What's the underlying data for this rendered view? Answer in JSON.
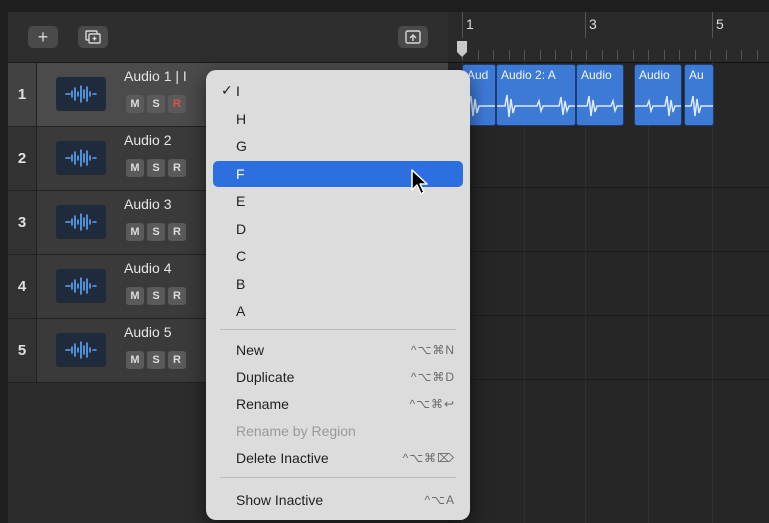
{
  "toolbar": {
    "add_label": "+"
  },
  "tracks": [
    {
      "number": "1",
      "name": "Audio 1 | I",
      "mute": "M",
      "solo": "S",
      "rec": "R"
    },
    {
      "number": "2",
      "name": "Audio 2",
      "mute": "M",
      "solo": "S",
      "rec": "R"
    },
    {
      "number": "3",
      "name": "Audio 3",
      "mute": "M",
      "solo": "S",
      "rec": "R"
    },
    {
      "number": "4",
      "name": "Audio 4",
      "mute": "M",
      "solo": "S",
      "rec": "R"
    },
    {
      "number": "5",
      "name": "Audio 5",
      "mute": "M",
      "solo": "S",
      "rec": "R"
    }
  ],
  "ruler": {
    "bars": [
      "1",
      "3",
      "5"
    ]
  },
  "regions": [
    "Aud",
    "Audio 2: A",
    "Audio",
    "Audio",
    "Au"
  ],
  "menu": {
    "check_mark": "✓",
    "take_letters": [
      "I",
      "H",
      "G",
      "F",
      "E",
      "D",
      "C",
      "B",
      "A"
    ],
    "selected_take": "I",
    "highlighted_take": "F",
    "commands": [
      {
        "label": "New",
        "shortcut": "^⌥⌘N",
        "enabled": true
      },
      {
        "label": "Duplicate",
        "shortcut": "^⌥⌘D",
        "enabled": true
      },
      {
        "label": "Rename",
        "shortcut": "^⌥⌘↩",
        "enabled": true
      },
      {
        "label": "Rename by Region",
        "shortcut": "",
        "enabled": false
      },
      {
        "label": "Delete Inactive",
        "shortcut": "^⌥⌘⌦",
        "enabled": true
      }
    ],
    "show_inactive": {
      "label": "Show Inactive",
      "shortcut": "^⌥A"
    }
  },
  "colors": {
    "region": "#3d7ad6",
    "highlight": "#2e6fe0",
    "record": "#d9534f"
  }
}
